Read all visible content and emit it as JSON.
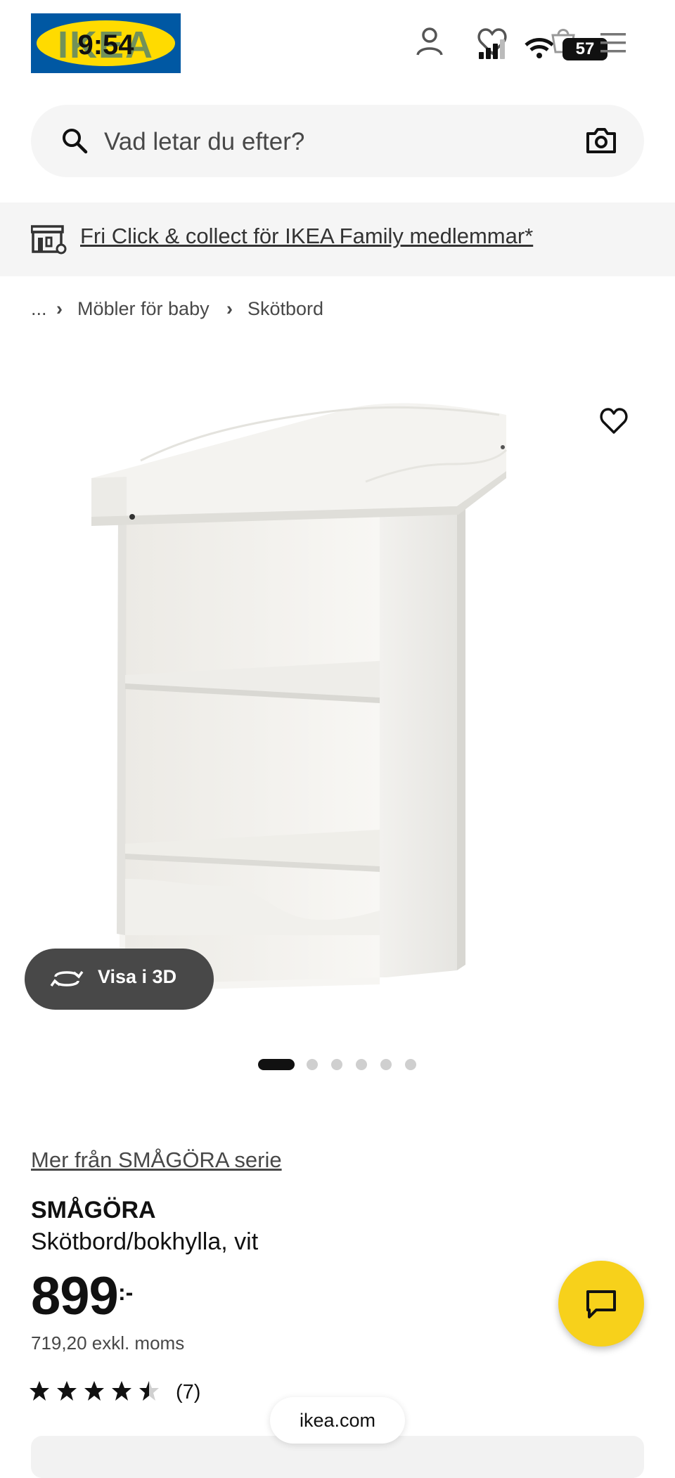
{
  "status_bar": {
    "time": "9:54",
    "battery": "57"
  },
  "header": {
    "logo_text": "IKEA"
  },
  "search": {
    "placeholder": "Vad letar du efter?"
  },
  "banner": {
    "text": "Fri Click & collect för IKEA Family medlemmar*"
  },
  "breadcrumb": {
    "items": [
      "...",
      "Möbler för baby",
      "Skötbord"
    ]
  },
  "gallery": {
    "view_3d_label": "Visa i 3D",
    "image_count": 6,
    "active_index": 0
  },
  "product": {
    "series_link": "Mer från SMÅGÖRA serie",
    "name": "SMÅGÖRA",
    "description": "Skötbord/bokhylla, vit",
    "price": "899",
    "price_suffix": ":-",
    "price_ex_vat": "719,20 exkl. moms",
    "rating": 4.5,
    "review_count": "(7)"
  },
  "browser": {
    "url": "ikea.com"
  },
  "colors": {
    "ikea_blue": "#0058a3",
    "ikea_yellow": "#ffdb00",
    "chat_yellow": "#f7d11b",
    "dark_button": "#484848"
  }
}
